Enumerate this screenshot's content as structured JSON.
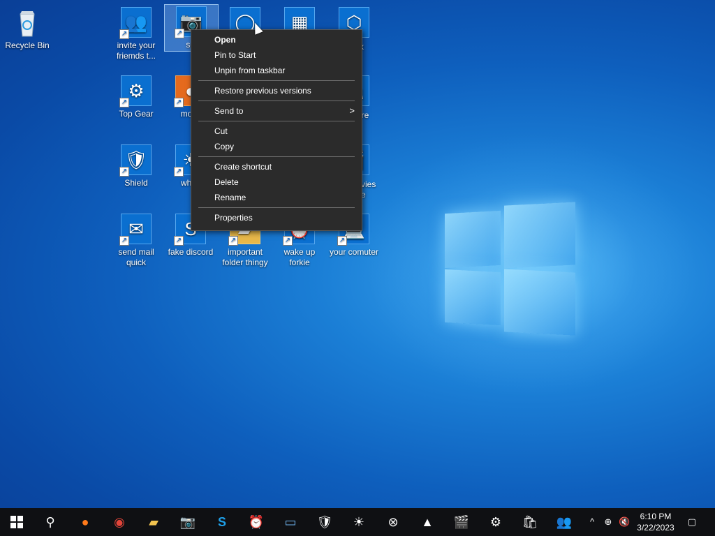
{
  "desktop": {
    "icons": [
      {
        "label": "Recycle Bin",
        "icon": "recycle-bin-icon"
      },
      {
        "label": "invite your friemds t...",
        "icon": "people-icon"
      },
      {
        "label": "sel",
        "icon": "camera-icon"
      },
      {
        "label": "",
        "icon": "cortana-icon"
      },
      {
        "label": "",
        "icon": "calculator-icon"
      },
      {
        "label": "x",
        "icon": "3d-box-icon"
      },
      {
        "label": "Top Gear",
        "icon": "gear-icon"
      },
      {
        "label": "mozz",
        "icon": "firefox-icon"
      },
      {
        "label": "ore",
        "icon": "store-icon"
      },
      {
        "label": "Shield",
        "icon": "shield-icon"
      },
      {
        "label": "white",
        "icon": "sun-icon"
      },
      {
        "label": "vies",
        "icon": "movies-icon"
      },
      {
        "label": "e",
        "icon": "movies-icon"
      },
      {
        "label": "send mail quick",
        "icon": "mail-icon"
      },
      {
        "label": "fake discord",
        "icon": "skype-icon"
      },
      {
        "label": "important folder thingy",
        "icon": "folder-icon"
      },
      {
        "label": "wake up forkie",
        "icon": "alarm-icon"
      },
      {
        "label": "your comuter",
        "icon": "computer-icon"
      }
    ]
  },
  "context_menu": {
    "items": [
      {
        "label": "Open",
        "bold": true
      },
      {
        "label": "Pin to Start"
      },
      {
        "label": "Unpin from taskbar"
      },
      {
        "label": "Restore previous versions"
      },
      {
        "label": "Send to",
        "submenu_arrow": ">"
      },
      {
        "label": "Cut"
      },
      {
        "label": "Copy"
      },
      {
        "label": "Create shortcut"
      },
      {
        "label": "Delete"
      },
      {
        "label": "Rename"
      },
      {
        "label": "Properties"
      }
    ]
  },
  "taskbar": {
    "buttons": [
      "start-icon",
      "search-icon",
      "firefox-icon",
      "chrome-icon",
      "file-explorer-icon",
      "camera-icon",
      "skype-icon",
      "alarm-icon",
      "mail-icon",
      "shield-icon",
      "sun-icon",
      "xbox-icon",
      "photos-icon",
      "movies-icon",
      "settings-icon",
      "store-icon",
      "people-icon"
    ],
    "tray": [
      "chevron-up-icon",
      "network-icon",
      "volume-muted-icon",
      "notifications-icon"
    ],
    "clock": {
      "time": "6:10 PM",
      "date": "3/22/2023"
    }
  },
  "colors": {
    "menu_bg": "#2b2b2b",
    "taskbar_bg": "#0f1013",
    "desktop_blue": "#0e5fbd"
  }
}
